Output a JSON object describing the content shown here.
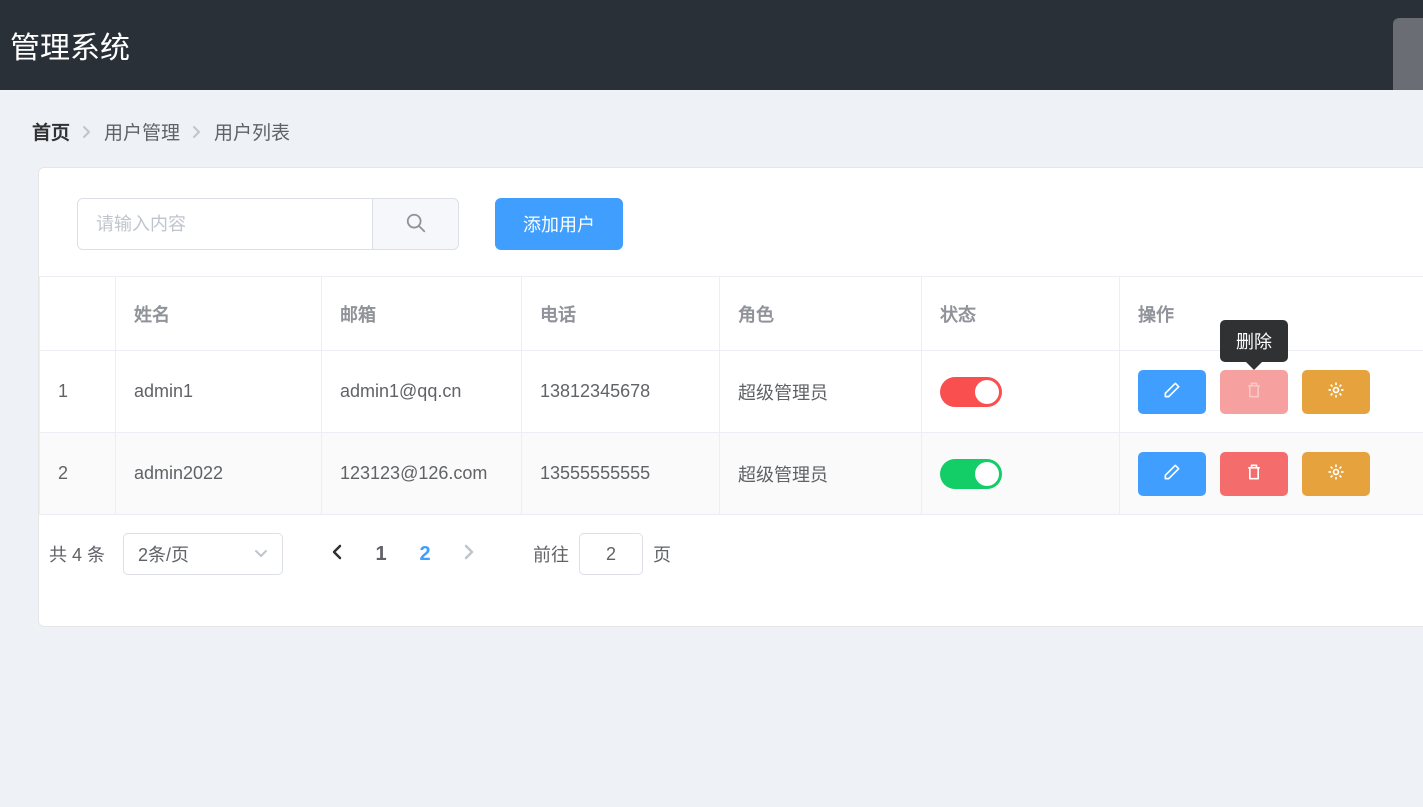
{
  "header": {
    "title": "管理系统"
  },
  "breadcrumb": {
    "items": [
      "首页",
      "用户管理",
      "用户列表"
    ]
  },
  "toolbar": {
    "search_placeholder": "请输入内容",
    "add_user_label": "添加用户"
  },
  "table": {
    "headers": {
      "index": "",
      "name": "姓名",
      "email": "邮箱",
      "phone": "电话",
      "role": "角色",
      "state": "状态",
      "ops": "操作"
    },
    "rows": [
      {
        "idx": "1",
        "name": "admin1",
        "email": "admin1@qq.cn",
        "phone": "13812345678",
        "role": "超级管理员",
        "state_on": false
      },
      {
        "idx": "2",
        "name": "admin2022",
        "email": "123123@126.com",
        "phone": "13555555555",
        "role": "超级管理员",
        "state_on": true
      }
    ]
  },
  "tooltip": {
    "delete_label": "删除"
  },
  "pagination": {
    "total_text": "共 4 条",
    "page_size_text": "2条/页",
    "pages": [
      "1",
      "2"
    ],
    "active_page": "2",
    "jump_prefix": "前往",
    "jump_value": "2",
    "jump_suffix": "页"
  },
  "colors": {
    "primary": "#409eff",
    "danger": "#f56c6c",
    "warning": "#e6a23c",
    "success": "#13ce66",
    "off": "#fa4f4f"
  }
}
